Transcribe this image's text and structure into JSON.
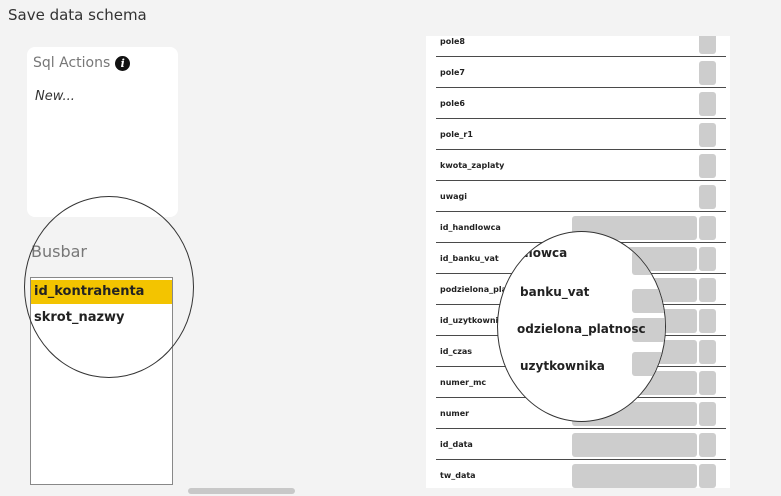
{
  "title": "Save data schema",
  "sql_actions": {
    "header": "Sql Actions",
    "new_label": "New..."
  },
  "busbar": {
    "label": "Busbar",
    "items": [
      {
        "label": "id_kontrahenta",
        "selected": true
      },
      {
        "label": "skrot_nazwy",
        "selected": false
      }
    ]
  },
  "fields": [
    {
      "label": "pole8",
      "wide": false
    },
    {
      "label": "pole7",
      "wide": false
    },
    {
      "label": "pole6",
      "wide": false
    },
    {
      "label": "pole_r1",
      "wide": false
    },
    {
      "label": "kwota_zaplaty",
      "wide": false
    },
    {
      "label": "uwagi",
      "wide": false
    },
    {
      "label": "id_handlowca",
      "wide": true
    },
    {
      "label": "id_banku_vat",
      "wide": true
    },
    {
      "label": "podzielona_platnosc",
      "wide": true
    },
    {
      "label": "id_uzytkownika",
      "wide": true
    },
    {
      "label": "id_czas",
      "wide": true
    },
    {
      "label": "numer_mc",
      "wide": true
    },
    {
      "label": "numer",
      "wide": true
    },
    {
      "label": "id_data",
      "wide": true
    },
    {
      "label": "tw_data",
      "wide": true
    }
  ],
  "zoom": {
    "lines": [
      "dlowca",
      "banku_vat",
      "odzielona_platnosc",
      "uzytkownika"
    ]
  },
  "colors": {
    "selected": "#f3c400",
    "field_box": "#cdcdcd"
  }
}
